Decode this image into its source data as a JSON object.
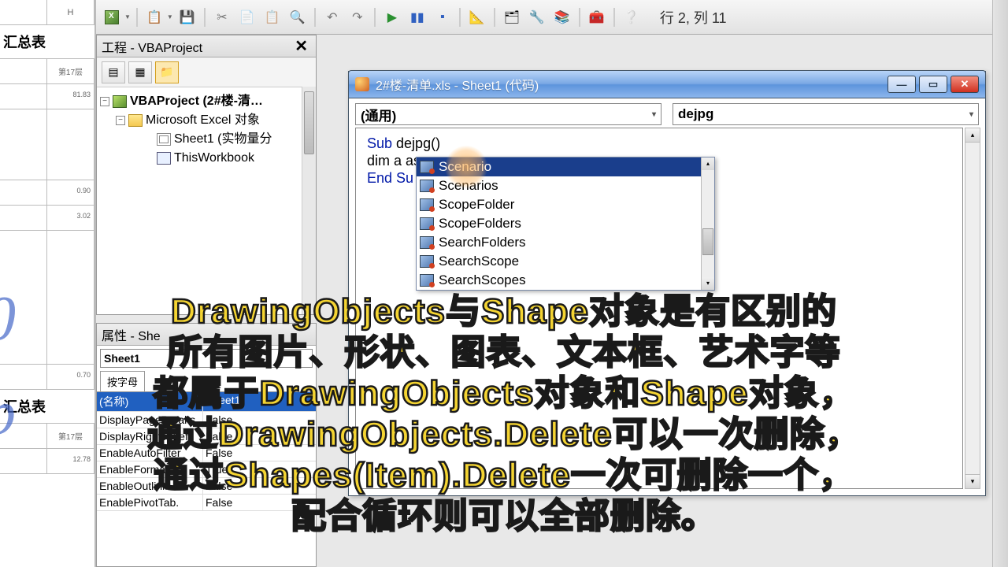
{
  "toolbar": {
    "cursor_pos": "行 2, 列 11"
  },
  "project_pane": {
    "title": "工程 - VBAProject",
    "root": "VBAProject (2#楼-清…",
    "folder": "Microsoft Excel 对象",
    "sheet1": "Sheet1 (实物量分",
    "thiswb": "ThisWorkbook"
  },
  "props_pane": {
    "title": "属性 - She",
    "combo_name": "Sheet1",
    "tab1": "按字母",
    "rows": [
      {
        "k": "(名称)",
        "v": "Sheet1",
        "sel": true
      },
      {
        "k": "DisplayPageBreaks",
        "v": "False"
      },
      {
        "k": "DisplayRightToLeft",
        "v": "False"
      },
      {
        "k": "EnableAutoFilter",
        "v": "False"
      },
      {
        "k": "EnableFormatCo",
        "v": "True"
      },
      {
        "k": "EnableOutlinin",
        "v": "False"
      },
      {
        "k": "EnablePivotTab.",
        "v": "False"
      }
    ]
  },
  "bg_sheet": {
    "col_h": "H",
    "title1": "汇总表",
    "lbl17": "第17层",
    "v1": "81.83",
    "v2": "0.90",
    "v3": "3.02",
    "v4": "0.70",
    "title2": "汇总表",
    "v5": "12.78"
  },
  "code_win": {
    "title": "2#楼-清单.xls - Sheet1 (代码)",
    "combo_left": "(通用)",
    "combo_right": "dejpg",
    "line1_a": "Sub",
    "line1_b": " dejpg()",
    "line2": "dim a as s",
    "line3": "End Su"
  },
  "intellisense": {
    "items": [
      "Scenario",
      "Scenarios",
      "ScopeFolder",
      "ScopeFolders",
      "SearchFolders",
      "SearchScope",
      "SearchScopes"
    ],
    "selected": 0
  },
  "subtitle": {
    "l1": "DrawingObjects与Shape对象是有区别的",
    "l2": "所有图片、形状、图表、文本框、艺术字等",
    "l3": "都属于DrawingObjects对象和Shape对象，",
    "l4": "通过DrawingObjects.Delete可以一次删除，",
    "l5": "通过Shapes(Item).Delete一次可删除一个，",
    "l6": "配合循环则可以全部删除。"
  }
}
